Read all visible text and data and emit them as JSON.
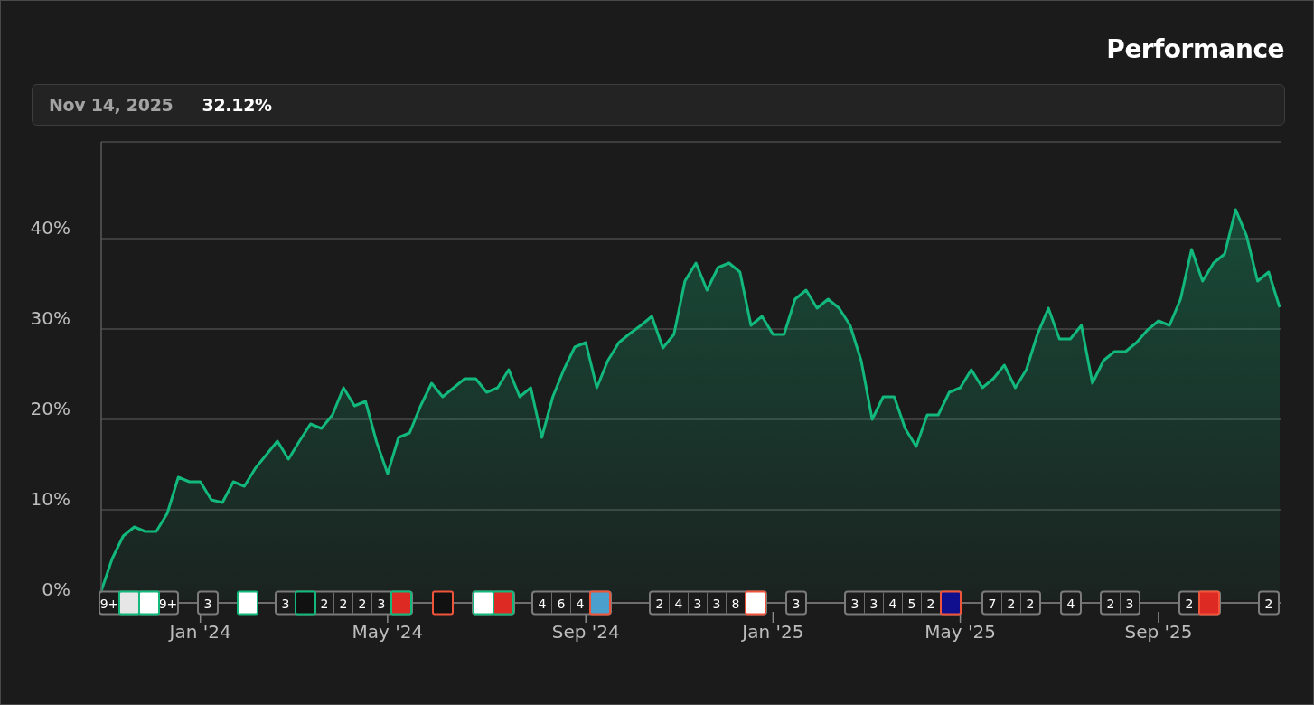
{
  "summary": {
    "date": "Nov 14, 2025",
    "value": "32.12%"
  },
  "chart_data": {
    "type": "area",
    "title": "Performance",
    "grid": true,
    "ylim": [
      0,
      50.7
    ],
    "yticks": [
      {
        "value": 0,
        "label": "0%"
      },
      {
        "value": 10,
        "label": "10%"
      },
      {
        "value": 20,
        "label": "20%"
      },
      {
        "value": 30,
        "label": "30%"
      },
      {
        "value": 40,
        "label": "40%"
      }
    ],
    "categories": [
      null,
      null,
      null,
      null,
      null,
      null,
      null,
      null,
      null,
      "Jan '24",
      null,
      null,
      null,
      null,
      null,
      null,
      null,
      null,
      null,
      null,
      null,
      null,
      null,
      null,
      null,
      null,
      "May '24",
      null,
      null,
      null,
      null,
      null,
      null,
      null,
      null,
      null,
      null,
      null,
      null,
      null,
      null,
      null,
      null,
      null,
      "Sep '24",
      null,
      null,
      null,
      null,
      null,
      null,
      null,
      null,
      null,
      null,
      null,
      null,
      null,
      null,
      null,
      null,
      "Jan '25",
      null,
      null,
      null,
      null,
      null,
      null,
      null,
      null,
      null,
      null,
      null,
      null,
      null,
      null,
      null,
      null,
      "May '25",
      null,
      null,
      null,
      null,
      null,
      null,
      null,
      null,
      null,
      null,
      null,
      null,
      null,
      null,
      null,
      null,
      null,
      "Sep '25",
      null,
      null,
      null,
      null,
      null,
      null,
      null,
      null,
      null,
      null,
      null
    ],
    "series": [
      {
        "color": "#12b87c",
        "values": [
          1,
          4.6,
          7.1,
          8.1,
          7.6,
          7.6,
          9.6,
          13.6,
          13.1,
          13.1,
          11.1,
          10.8,
          13.1,
          12.6,
          14.6,
          16.1,
          17.6,
          15.6,
          17.6,
          19.5,
          19,
          20.5,
          23.5,
          21.5,
          22,
          17.5,
          14,
          18,
          18.5,
          21.5,
          24,
          22.5,
          23.5,
          24.5,
          24.5,
          23,
          23.5,
          25.5,
          22.5,
          23.5,
          18,
          22.5,
          25.5,
          28,
          28.5,
          23.5,
          26.5,
          28.5,
          29.5,
          30.4,
          31.4,
          27.9,
          29.4,
          35.3,
          37.3,
          34.3,
          36.8,
          37.3,
          36.3,
          30.4,
          31.4,
          29.4,
          29.4,
          33.3,
          34.3,
          32.3,
          33.3,
          32.3,
          30.4,
          26.5,
          20,
          22.5,
          22.5,
          19,
          17,
          20.5,
          20.5,
          23,
          23.5,
          25.5,
          23.5,
          24.5,
          26,
          23.5,
          25.5,
          29.4,
          32.3,
          28.9,
          28.9,
          30.4,
          24,
          26.5,
          27.5,
          27.5,
          28.5,
          29.9,
          30.9,
          30.4,
          33.3,
          38.8,
          35.3,
          37.3,
          38.3,
          43.2,
          40.3,
          35.3,
          36.3,
          32.4
        ]
      }
    ]
  },
  "event_markers": [
    {
      "items": [
        {
          "kind": "count",
          "text": "9+"
        },
        {
          "kind": "greylogo",
          "color": "#12b87c"
        },
        {
          "kind": "whitelogo",
          "color": "#12b87c"
        },
        {
          "kind": "count",
          "text": "9+"
        }
      ]
    },
    {
      "items": [
        {
          "kind": "count",
          "text": "3"
        }
      ]
    },
    {
      "items": [
        {
          "kind": "whitelogo",
          "color": "#12b87c"
        }
      ]
    },
    {
      "items": [
        {
          "kind": "count",
          "text": "3"
        },
        {
          "kind": "darklogo",
          "color": "#12b87c"
        },
        {
          "kind": "count",
          "text": "2"
        },
        {
          "kind": "count",
          "text": "2"
        },
        {
          "kind": "count",
          "text": "2"
        },
        {
          "kind": "count",
          "text": "3"
        },
        {
          "kind": "redlogo",
          "color": "#12b87c"
        }
      ]
    },
    {
      "items": [
        {
          "kind": "darklogo",
          "color": "#f0553c"
        }
      ]
    },
    {
      "items": [
        {
          "kind": "whitelogo",
          "color": "#12b87c"
        },
        {
          "kind": "redlogo",
          "color": "#12b87c"
        }
      ]
    },
    {
      "items": [
        {
          "kind": "count",
          "text": "4"
        },
        {
          "kind": "count",
          "text": "6"
        },
        {
          "kind": "count",
          "text": "4"
        },
        {
          "kind": "bluelogo",
          "color": "#f0553c"
        }
      ]
    },
    {
      "items": [
        {
          "kind": "count",
          "text": "2"
        },
        {
          "kind": "count",
          "text": "4"
        },
        {
          "kind": "count",
          "text": "3"
        },
        {
          "kind": "count",
          "text": "3"
        },
        {
          "kind": "count",
          "text": "8"
        },
        {
          "kind": "whitelogo",
          "color": "#f0553c"
        }
      ]
    },
    {
      "items": [
        {
          "kind": "count",
          "text": "3"
        }
      ]
    },
    {
      "items": [
        {
          "kind": "count",
          "text": "3"
        },
        {
          "kind": "count",
          "text": "3"
        },
        {
          "kind": "count",
          "text": "4"
        },
        {
          "kind": "count",
          "text": "5"
        },
        {
          "kind": "count",
          "text": "2"
        },
        {
          "kind": "navylogo",
          "color": "#f0553c"
        }
      ]
    },
    {
      "items": [
        {
          "kind": "count",
          "text": "7"
        },
        {
          "kind": "count",
          "text": "2"
        },
        {
          "kind": "count",
          "text": "2"
        }
      ]
    },
    {
      "items": [
        {
          "kind": "count",
          "text": "4"
        }
      ]
    },
    {
      "items": [
        {
          "kind": "count",
          "text": "2"
        },
        {
          "kind": "count",
          "text": "3"
        }
      ]
    },
    {
      "items": [
        {
          "kind": "count",
          "text": "2"
        },
        {
          "kind": "redlogo",
          "color": "#f0553c"
        }
      ]
    },
    {
      "items": [
        {
          "kind": "count",
          "text": "2"
        }
      ]
    }
  ]
}
